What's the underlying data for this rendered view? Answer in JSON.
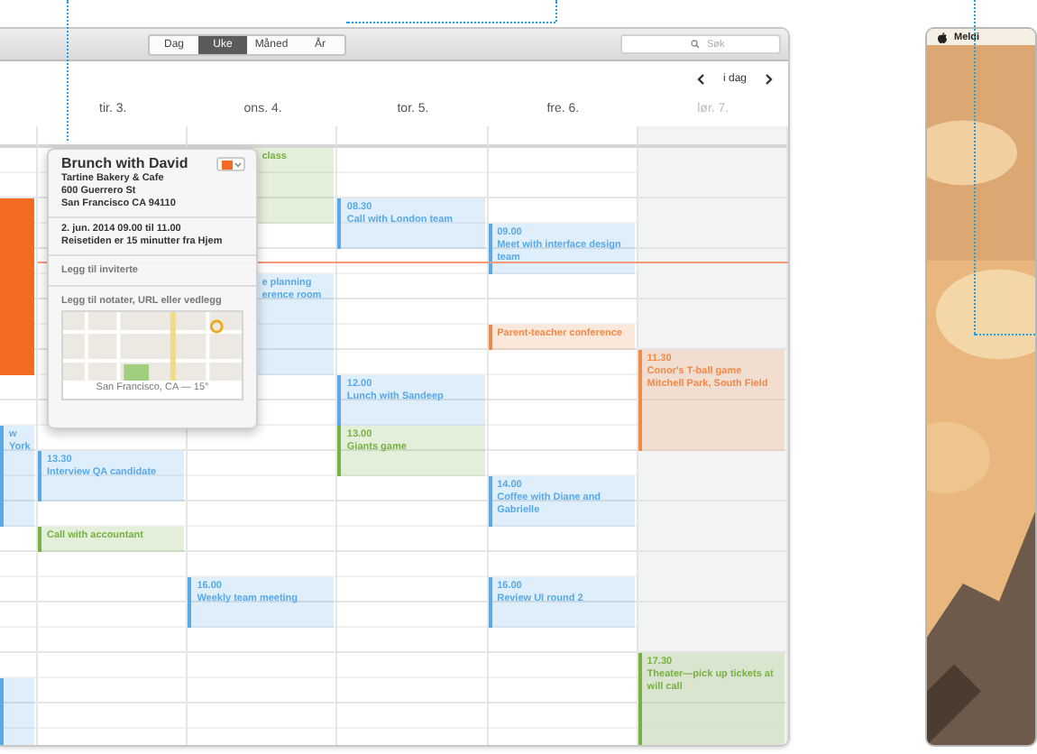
{
  "calendar": {
    "view_switcher": [
      {
        "label": "Dag",
        "selected": false
      },
      {
        "label": "Uke",
        "selected": true
      },
      {
        "label": "Måned",
        "selected": false
      },
      {
        "label": "År",
        "selected": false
      }
    ],
    "search": {
      "placeholder": "Søk"
    },
    "today_button": "i dag",
    "days": [
      {
        "weekend": false,
        "slots": [
          {
            "kind": "free"
          },
          {
            "kind": "free"
          },
          {
            "kind": "seven",
            "color": "#f26b21",
            "selected": true,
            "cut_left": false
          },
          {
            "kind": "free"
          },
          {
            "kind": "free"
          },
          {
            "kind": "four",
            "title": "w York",
            "color": "#5aa9e6",
            "selected": false,
            "cut_left": false
          },
          {
            "kind": "free"
          },
          {
            "kind": "free"
          },
          {
            "kind": "free"
          },
          {
            "kind": "free"
          },
          {
            "kind": "free"
          },
          {
            "kind": "free"
          },
          {
            "kind": "three",
            "color": "#5aa9e6",
            "selected": false,
            "cut_left": false
          }
        ]
      },
      {
        "label": "tir. 3.",
        "weekend": false,
        "slots": [
          {
            "kind": "free"
          },
          {
            "kind": "free"
          },
          {
            "kind": "free"
          },
          {
            "kind": "free"
          },
          {
            "kind": "free"
          },
          {
            "kind": "free"
          },
          {
            "kind": "free"
          },
          {
            "kind": "free"
          },
          {
            "kind": "free"
          },
          {
            "kind": "free"
          },
          {
            "kind": "free"
          },
          {
            "kind": "free"
          },
          {
            "kind": "two",
            "time": "13.30",
            "title": "Interview QA candidate",
            "color": "#5aa9e6",
            "selected": false,
            "cut_left": false
          },
          {
            "kind": "free"
          },
          {
            "kind": "one",
            "title": "Call with accountant",
            "color": "#78b043",
            "selected": false,
            "cut_left": false
          }
        ]
      },
      {
        "label": "ons. 4.",
        "weekend": false,
        "slots": [
          {
            "kind": "three",
            "title": "class",
            "color": "#78b043",
            "selected": false,
            "cut_left": true
          },
          {
            "kind": "free"
          },
          {
            "kind": "free"
          },
          {
            "kind": "four",
            "title": "e planning erence room",
            "color": "#5aa9e6",
            "selected": false,
            "cut_left": true
          },
          {
            "kind": "free"
          },
          {
            "kind": "free"
          },
          {
            "kind": "free"
          },
          {
            "kind": "free"
          },
          {
            "kind": "free"
          },
          {
            "kind": "free"
          },
          {
            "kind": "free"
          },
          {
            "kind": "free"
          },
          {
            "kind": "two",
            "time": "16.00",
            "title": "Weekly team meeting",
            "color": "#5aa9e6",
            "selected": false,
            "cut_left": false
          }
        ]
      },
      {
        "label": "tor. 5.",
        "weekend": false,
        "slots": [
          {
            "kind": "free"
          },
          {
            "kind": "free"
          },
          {
            "kind": "two",
            "time": "08.30",
            "title": "Call with London team",
            "color": "#5aa9e6",
            "selected": false,
            "cut_left": false
          },
          {
            "kind": "free"
          },
          {
            "kind": "free"
          },
          {
            "kind": "free"
          },
          {
            "kind": "free"
          },
          {
            "kind": "free"
          },
          {
            "kind": "two",
            "time": "12.00",
            "title": "Lunch with Sandeep",
            "color": "#5aa9e6",
            "selected": false,
            "cut_left": false
          },
          {
            "kind": "two",
            "time": "13.00",
            "title": "Giants game",
            "color": "#78b043",
            "selected": false,
            "cut_left": false
          }
        ]
      },
      {
        "label": "fre. 6.",
        "weekend": false,
        "slots": [
          {
            "kind": "free"
          },
          {
            "kind": "free"
          },
          {
            "kind": "free"
          },
          {
            "kind": "two",
            "time": "09.00",
            "title": "Meet with interface design team",
            "color": "#5aa9e6",
            "selected": false,
            "cut_left": false
          },
          {
            "kind": "free"
          },
          {
            "kind": "free"
          },
          {
            "kind": "one",
            "title": "Parent-teacher conference",
            "color": "#f08a4b",
            "selected": false,
            "cut_left": false
          },
          {
            "kind": "free"
          },
          {
            "kind": "free"
          },
          {
            "kind": "free"
          },
          {
            "kind": "free"
          },
          {
            "kind": "free"
          },
          {
            "kind": "two",
            "time": "14.00",
            "title": "Coffee with Diane and Gabrielle",
            "color": "#5aa9e6",
            "selected": false,
            "cut_left": false
          },
          {
            "kind": "free"
          },
          {
            "kind": "free"
          },
          {
            "kind": "two",
            "time": "16.00",
            "title": "Review UI round 2",
            "color": "#5aa9e6",
            "selected": false,
            "cut_left": false
          }
        ]
      },
      {
        "label": "lør. 7.",
        "weekend": true,
        "slots": [
          {
            "kind": "free"
          },
          {
            "kind": "free"
          },
          {
            "kind": "free"
          },
          {
            "kind": "free"
          },
          {
            "kind": "free"
          },
          {
            "kind": "free"
          },
          {
            "kind": "free"
          },
          {
            "kind": "free"
          },
          {
            "kind": "four",
            "time": "11.30",
            "title": "Conor's T-ball game",
            "location": "Mitchell Park, South Field",
            "color": "#f08a4b",
            "selected": false,
            "cut_left": false
          },
          {
            "kind": "free"
          },
          {
            "kind": "free"
          },
          {
            "kind": "free"
          },
          {
            "kind": "free"
          },
          {
            "kind": "free"
          },
          {
            "kind": "free"
          },
          {
            "kind": "free"
          },
          {
            "kind": "free"
          },
          {
            "kind": "four",
            "time": "17.30",
            "title": "Theater—pick up tickets at will call",
            "color": "#78b043",
            "selected": false,
            "cut_left": false
          }
        ]
      }
    ],
    "popover": {
      "title": "Brunch with David",
      "color": "#f26b21",
      "address": [
        "Tartine Bakery & Cafe",
        "600 Guerrero St",
        "San Francisco CA 94110"
      ],
      "when": "2. jun. 2014 09.00 til 11.00",
      "travel": "Reisetiden er 15 minutter fra Hjem",
      "invitees": "Legg til inviterte",
      "notes": "Legg til notater, URL eller vedlegg",
      "map": {
        "kind": "picture",
        "caption": "San Francisco, CA — 15°"
      }
    }
  },
  "desktop_preview": {
    "menu_title": "Meldi"
  }
}
